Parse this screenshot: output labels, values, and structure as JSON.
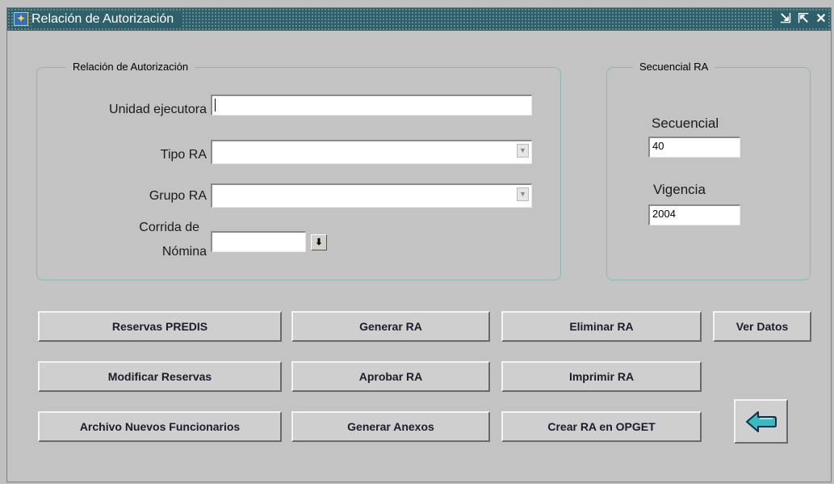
{
  "window": {
    "title": "Relación de Autorización",
    "icon": "app-icon",
    "controls": [
      "minimize-icon",
      "maximize-icon",
      "close-icon"
    ],
    "controls_glyphs": [
      "⇲",
      "⇱",
      "✕"
    ]
  },
  "group_main": {
    "title": "Relación de Autorización",
    "unidad_label": "Unidad ejecutora",
    "unidad_value": "",
    "tipo_label": "Tipo RA",
    "tipo_value": "",
    "grupo_label": "Grupo RA",
    "grupo_value": "",
    "corrida_label_1": "Corrida de",
    "corrida_label_2": "Nómina",
    "corrida_value": ""
  },
  "group_secuencial": {
    "title": "Secuencial RA",
    "secuencial_label": "Secuencial",
    "secuencial_value": "40",
    "vigencia_label": "Vigencia",
    "vigencia_value": "2004"
  },
  "buttons": {
    "reservas_predis": "Reservas PREDIS",
    "generar_ra": "Generar RA",
    "eliminar_ra": "Eliminar RA",
    "ver_datos": "Ver Datos",
    "modificar_reservas": "Modificar Reservas",
    "aprobar_ra": "Aprobar RA",
    "imprimir_ra": "Imprimir RA",
    "archivo_nuevos": "Archivo Nuevos Funcionarios",
    "generar_anexos": "Generar Anexos",
    "crear_ra_opget": "Crear RA en OPGET"
  },
  "colors": {
    "titlebar": "#2f5f6a",
    "background": "#c3c3c3",
    "group_border": "#8bb8b5",
    "back_arrow": "#3cb8c0"
  }
}
